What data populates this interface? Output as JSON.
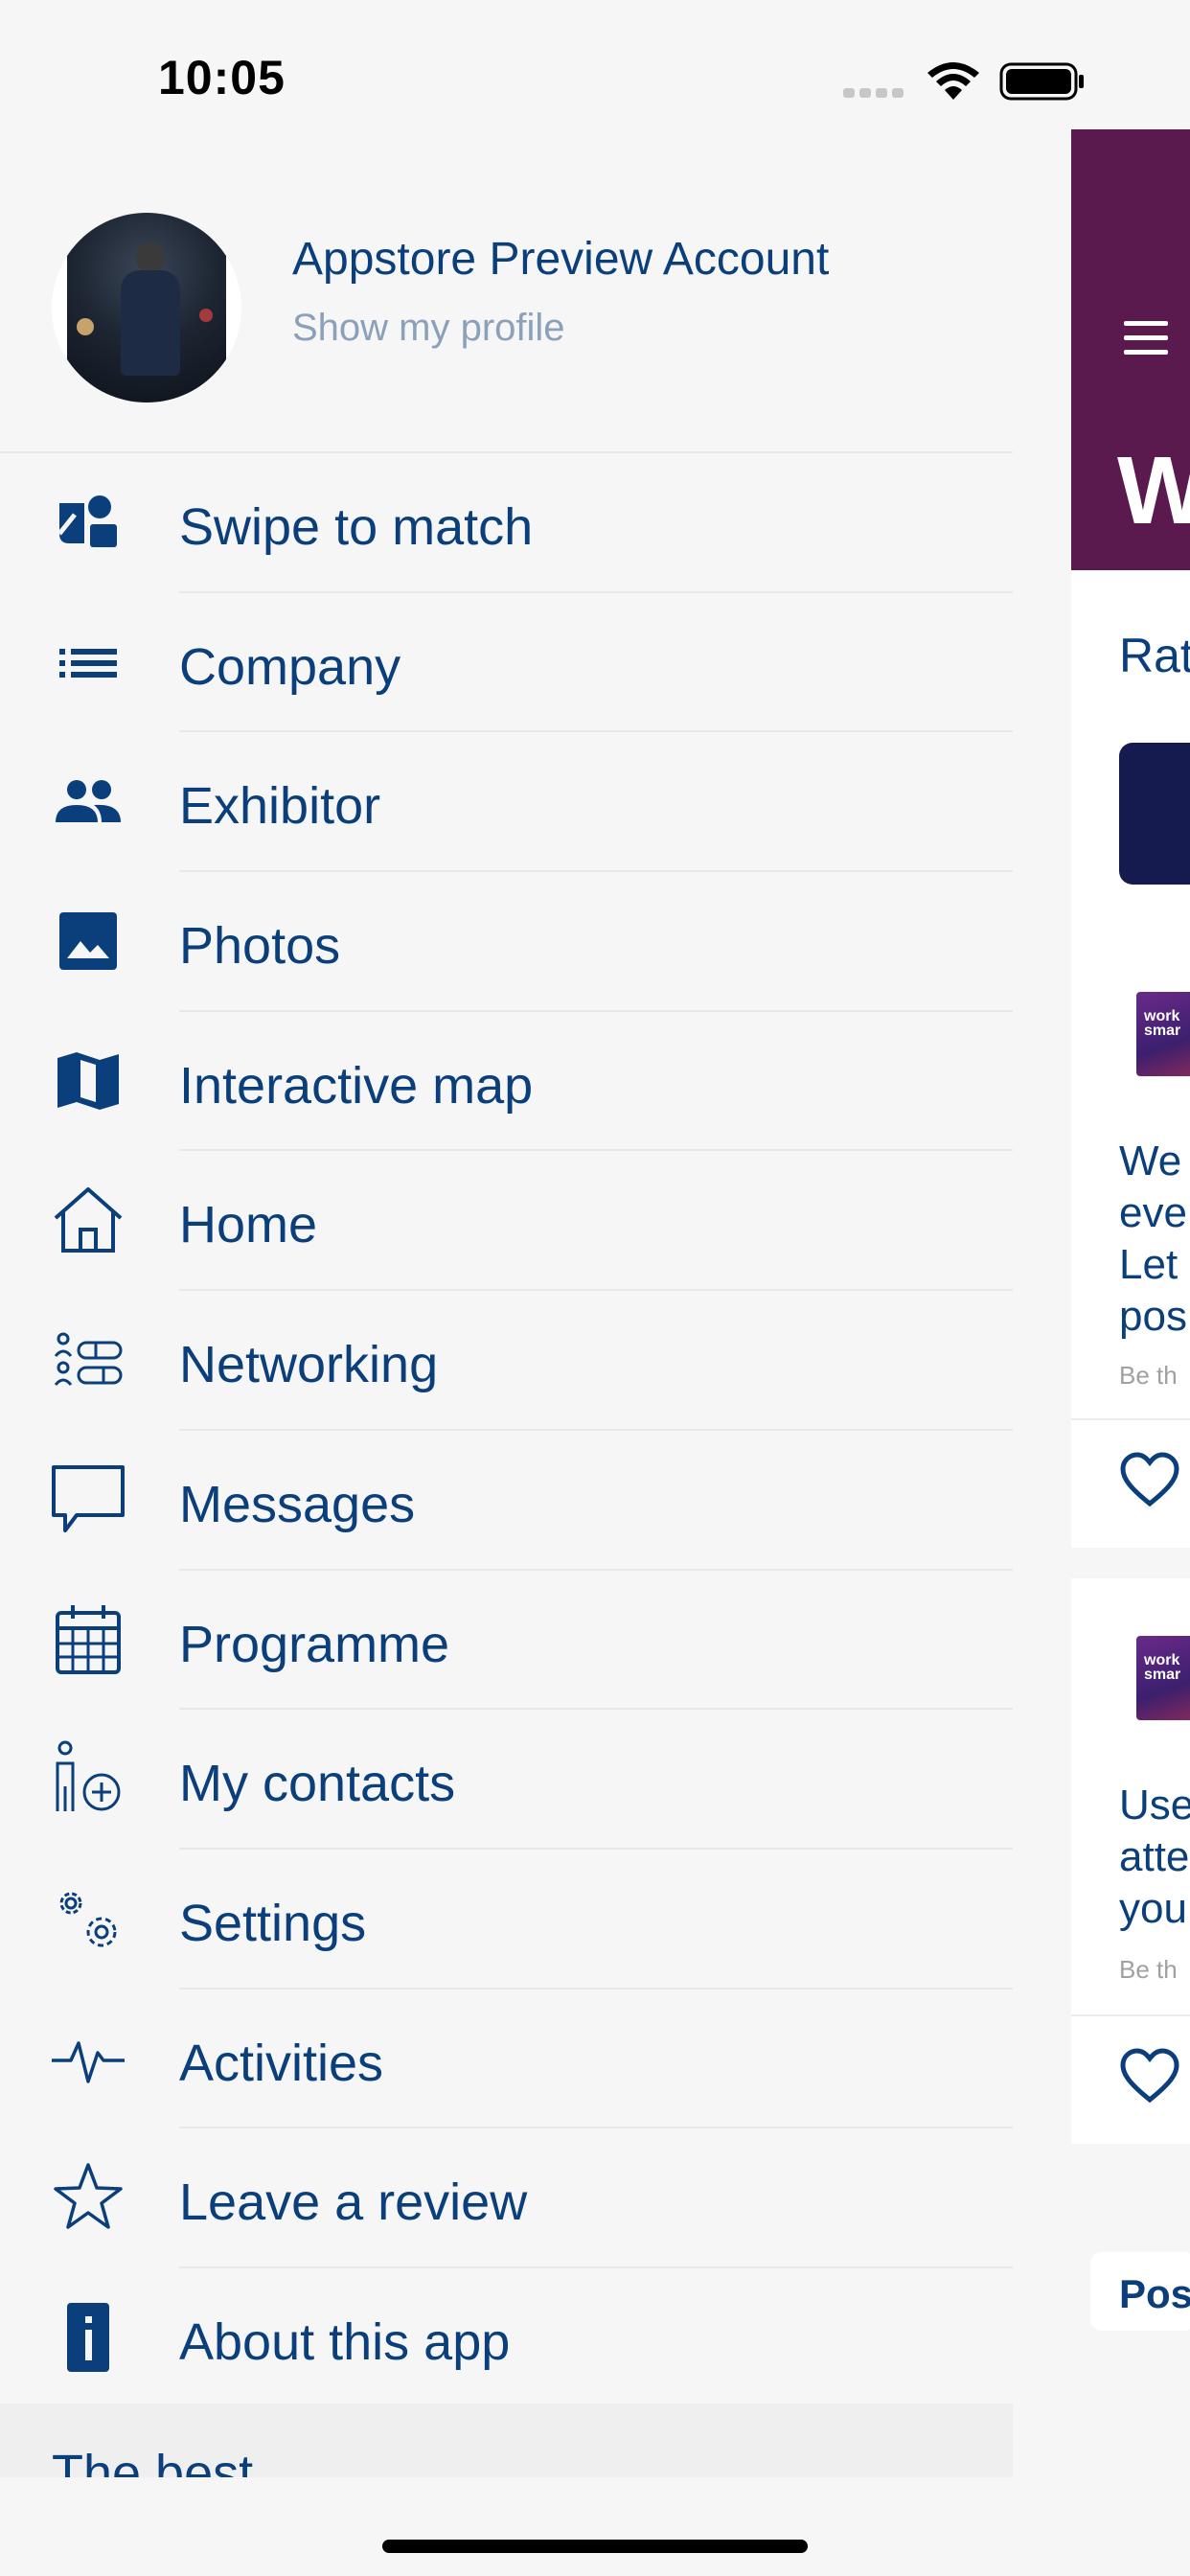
{
  "status_bar": {
    "time": "10:05"
  },
  "profile": {
    "name": "Appstore Preview Account",
    "subtitle": "Show my profile"
  },
  "menu": [
    {
      "label": "Swipe to match",
      "icon": "swipe-match-icon"
    },
    {
      "label": "Company",
      "icon": "list-icon"
    },
    {
      "label": "Exhibitor",
      "icon": "people-icon"
    },
    {
      "label": "Photos",
      "icon": "photo-icon"
    },
    {
      "label": "Interactive map",
      "icon": "map-icon"
    },
    {
      "label": "Home",
      "icon": "home-icon"
    },
    {
      "label": "Networking",
      "icon": "networking-icon"
    },
    {
      "label": "Messages",
      "icon": "chat-bubble-icon"
    },
    {
      "label": "Programme",
      "icon": "calendar-icon"
    },
    {
      "label": "My contacts",
      "icon": "add-contact-icon"
    },
    {
      "label": "Settings",
      "icon": "gears-icon"
    },
    {
      "label": "Activities",
      "icon": "pulse-icon"
    },
    {
      "label": "Leave a review",
      "icon": "star-icon"
    },
    {
      "label": "About this app",
      "icon": "info-icon"
    }
  ],
  "footer": {
    "label": "The best"
  },
  "background_page": {
    "title_fragment": "W",
    "rate_fragment": "Rat",
    "card1_lines": [
      "We",
      "ever",
      "Let",
      "pos"
    ],
    "card1_meta": "Be th",
    "card2_lines": [
      "Use",
      "atte",
      "you"
    ],
    "card2_meta": "Be th",
    "logo_text": "work smar",
    "post_fragment": "Pos"
  },
  "colors": {
    "header": "#5a1a4e",
    "text": "#0b3f7c",
    "button": "#161b4f"
  }
}
